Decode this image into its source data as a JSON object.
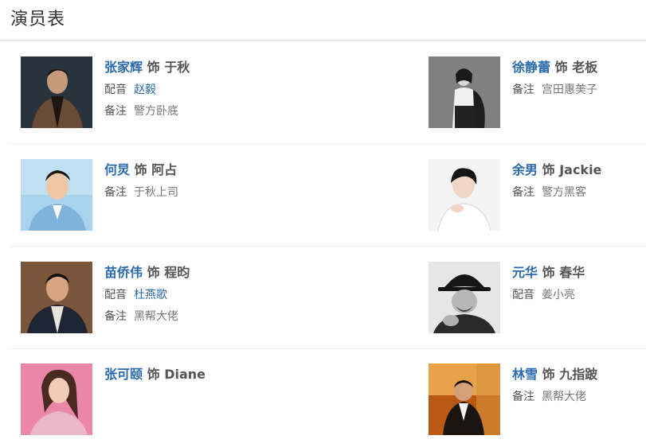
{
  "section": {
    "title": "演员表"
  },
  "labels": {
    "as": "饰",
    "dub": "配音",
    "note": "备注"
  },
  "cast": [
    {
      "actor": "张家辉",
      "role": "于秋",
      "dub": "赵毅",
      "note": "警方卧底"
    },
    {
      "actor": "徐静蕾",
      "role": "老板",
      "note": "宫田惠美子"
    },
    {
      "actor": "何炅",
      "role": "阿占",
      "note": "于秋上司"
    },
    {
      "actor": "余男",
      "role": "Jackie",
      "note": "警方黑客"
    },
    {
      "actor": "苗侨伟",
      "role": "程昀",
      "dub": "杜燕歌",
      "note": "黑帮大佬"
    },
    {
      "actor": "元华",
      "role": "春华",
      "dub": "姜小亮"
    },
    {
      "actor": "张可颐",
      "role": "Diane"
    },
    {
      "actor": "林雪",
      "role": "九指跛",
      "note": "黑帮大佬"
    }
  ],
  "colors": {
    "link": "#2a6bb0",
    "text": "#555555",
    "muted": "#777777",
    "divider": "#eeeeee"
  }
}
